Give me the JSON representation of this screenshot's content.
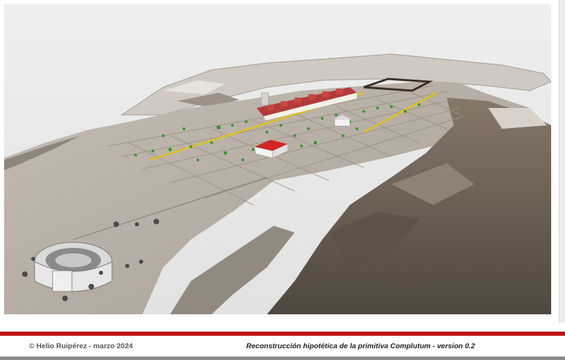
{
  "footer": {
    "copyright": "© Helio Ruipérez - marzo 2024",
    "title": "Reconstrucción hipotética de la primitiva Complutum - version 0.2"
  },
  "colors": {
    "accent_red": "#c0141b",
    "viewport_bg": "#e8e8e8",
    "terrain": "#b8afa5",
    "rock": "#6e6258",
    "street_yellow": "#e0c21a",
    "tree_green": "#2e9a2e"
  },
  "scene": {
    "description_icons": [
      "amphitheater-icon",
      "forum-building-icon",
      "fortified-camp-icon",
      "town-houses-icon",
      "tree-icon"
    ]
  }
}
